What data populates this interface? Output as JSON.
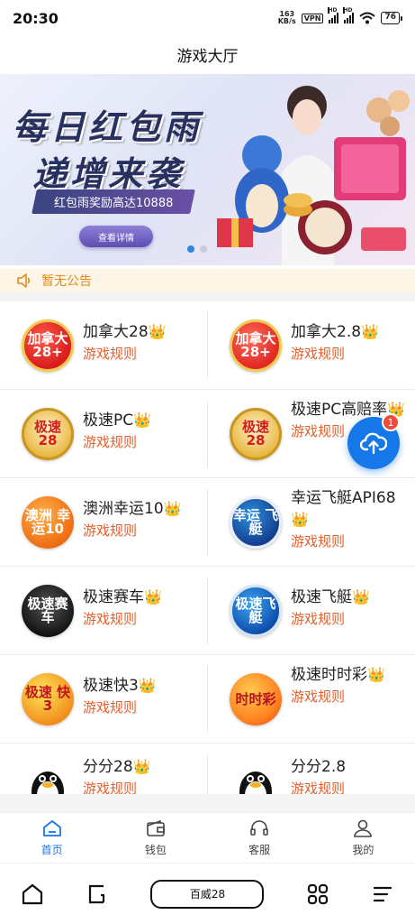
{
  "status_bar": {
    "time": "20:30",
    "net_speed_value": "163",
    "net_speed_unit": "KB/s",
    "vpn": "VPN",
    "signal_label": "HD",
    "battery": "76"
  },
  "header": {
    "title": "游戏大厅"
  },
  "banner": {
    "headline_1": "每日红包雨",
    "headline_2": "递增来袭",
    "tagline": "红包雨奖励高达10888",
    "cta": "查看详情",
    "slide_count": 2,
    "active_slide": 1
  },
  "notice": {
    "text": "暂无公告"
  },
  "crown": "👑",
  "games": [
    {
      "name": "加拿大28",
      "rule": "游戏规则",
      "icon_text": "加拿大 28+"
    },
    {
      "name": "加拿大2.8",
      "rule": "游戏规则",
      "icon_text": "加拿大 28+"
    },
    {
      "name": "极速PC",
      "rule": "游戏规则",
      "icon_text": "极速 28"
    },
    {
      "name": "极速PC高赔率",
      "rule": "游戏规则",
      "icon_text": "极速 28"
    },
    {
      "name": "澳洲幸运10",
      "rule": "游戏规则",
      "icon_text": "澳洲 幸运10"
    },
    {
      "name": "幸运飞艇API68",
      "rule": "游戏规则",
      "icon_text": "幸运 飞艇"
    },
    {
      "name": "极速赛车",
      "rule": "游戏规则",
      "icon_text": "极速赛车"
    },
    {
      "name": "极速飞艇",
      "rule": "游戏规则",
      "icon_text": "极速飞艇"
    },
    {
      "name": "极速快3",
      "rule": "游戏规则",
      "icon_text": "极速 快3"
    },
    {
      "name": "极速时时彩",
      "rule": "游戏规则",
      "icon_text": "时时彩"
    },
    {
      "name": "分分28",
      "rule": "游戏规则",
      "icon_text": ""
    },
    {
      "name": "分分2.8",
      "rule": "游戏规则",
      "icon_text": ""
    }
  ],
  "fab": {
    "badge": "1",
    "icon": "cloud-upload-icon"
  },
  "tabbar": {
    "items": [
      {
        "label": "首页",
        "icon": "home-icon",
        "active": true
      },
      {
        "label": "钱包",
        "icon": "wallet-icon",
        "active": false
      },
      {
        "label": "客服",
        "icon": "headset-icon",
        "active": false
      },
      {
        "label": "我的",
        "icon": "user-icon",
        "active": false
      }
    ]
  },
  "system_nav": {
    "app_label": "百威28"
  },
  "colors": {
    "accent": "#1677e8",
    "notice": "#e08a1f",
    "rule": "#e55f2a",
    "crown": "#f3b71c"
  }
}
